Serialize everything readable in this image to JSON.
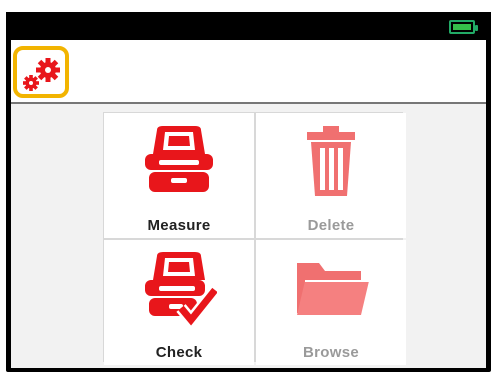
{
  "topbar": {
    "battery_icon": "battery-full-icon",
    "battery_color": "#35c04a"
  },
  "toolbar": {
    "settings_icon": "gears-icon",
    "highlight_color": "#f2b400"
  },
  "menu": {
    "tiles": [
      {
        "label": "Measure",
        "icon": "measure-device-icon",
        "enabled": true
      },
      {
        "label": "Delete",
        "icon": "trash-icon",
        "enabled": false
      },
      {
        "label": "Check",
        "icon": "check-device-icon",
        "enabled": true
      },
      {
        "label": "Browse",
        "icon": "folder-icon",
        "enabled": false
      }
    ]
  },
  "colors": {
    "accent_red": "#e8161b",
    "disabled_red": "#f07070"
  }
}
